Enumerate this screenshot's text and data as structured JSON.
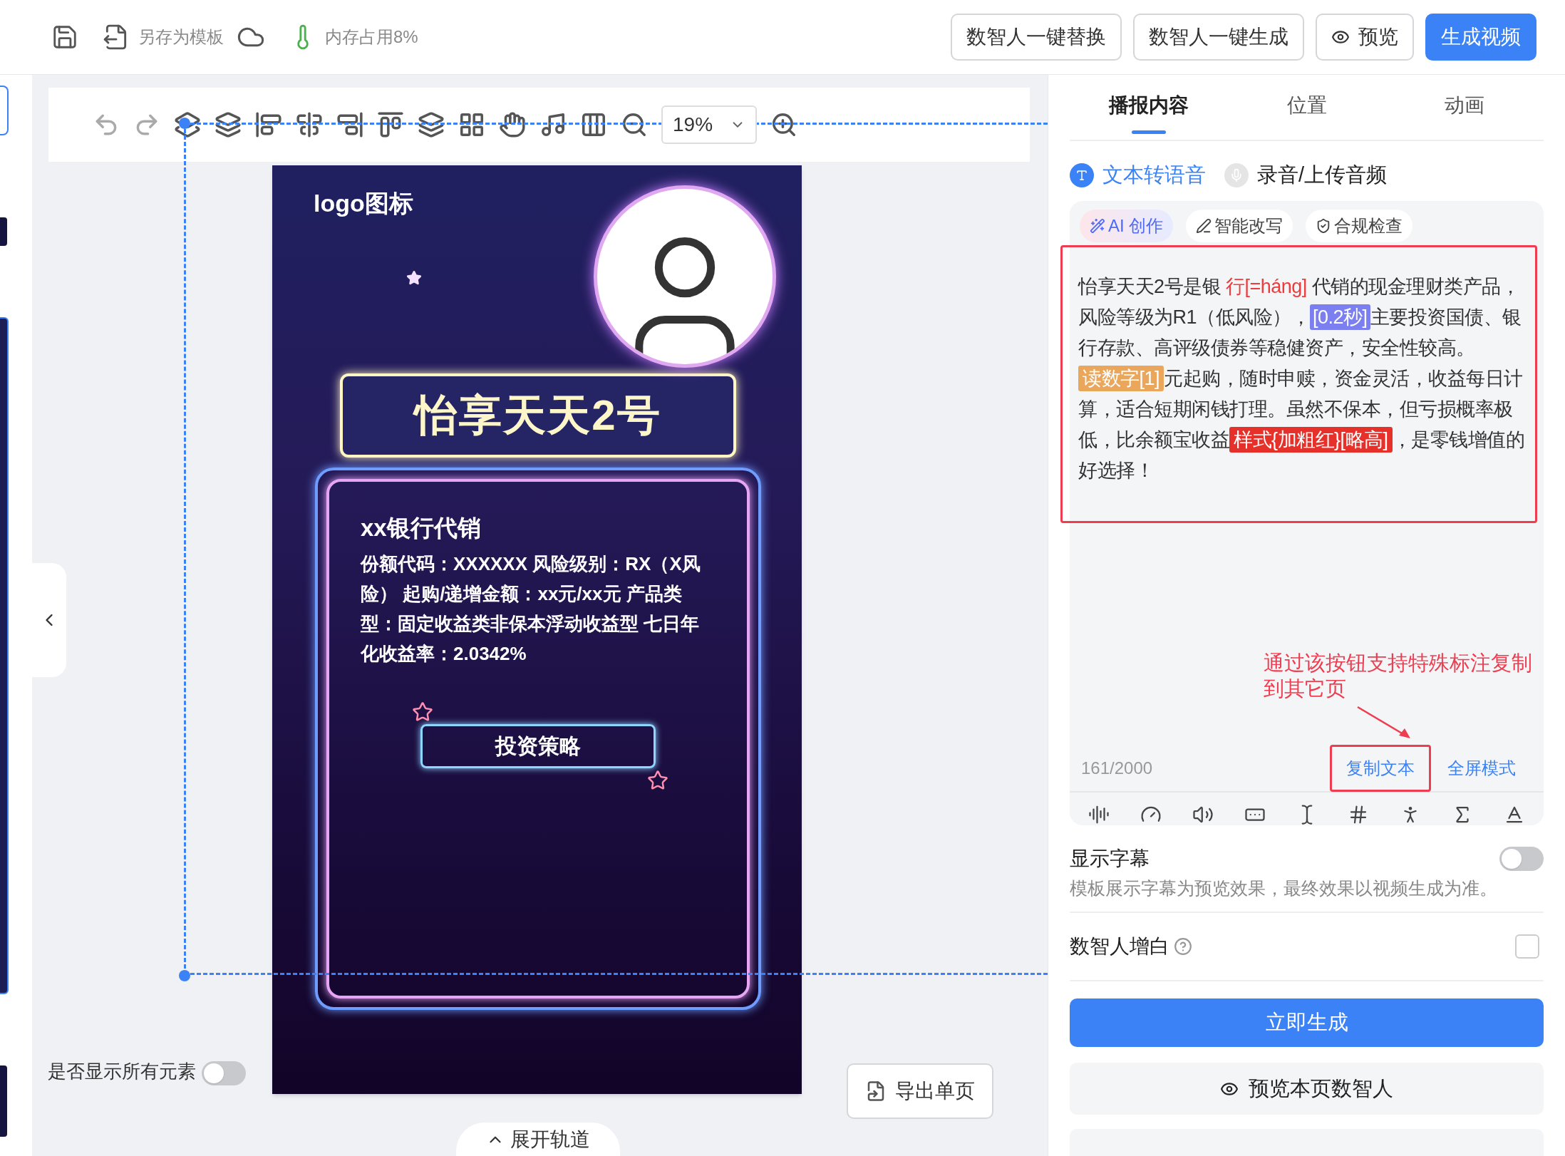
{
  "top_bar": {
    "save_as_template": "另存为模板",
    "memory_usage": "内存占用8%",
    "buttons": [
      {
        "label": "数智人一键替换",
        "kind": "outline"
      },
      {
        "label": "数智人一键生成",
        "kind": "outline"
      },
      {
        "label": "预览",
        "kind": "preview"
      },
      {
        "label": "生成视频",
        "kind": "primary"
      }
    ]
  },
  "editor_toolbar": {
    "zoom": "19%"
  },
  "poster": {
    "logo": "logo图标",
    "title": "怡享天天2号",
    "card_heading": "xx银行代销",
    "card_body": "份额代码：XXXXXX 风险级别：RX（X风险） 起购/递增金额：xx元/xx元 产品类型：固定收益类非保本浮动收益型 七日年化收益率：2.0342%",
    "button": "投资策略"
  },
  "canvas_footer": {
    "show_all_elements": {
      "label": "是否显示所有元素",
      "on": false
    },
    "export_button": "导出单页",
    "expand_track": "展开轨道"
  },
  "panel": {
    "tabs": [
      {
        "label": "播报内容",
        "selected": true
      },
      {
        "label": "位置",
        "selected": false
      },
      {
        "label": "动画",
        "selected": false
      }
    ],
    "modes": [
      {
        "label": "文本转语音",
        "kind": "tts",
        "selected": true
      },
      {
        "label": "录音/上传音频",
        "kind": "record",
        "selected": false
      }
    ],
    "chips": [
      {
        "label": "AI 创作",
        "kind": "ai"
      },
      {
        "label": "智能改写",
        "kind": "rewrite"
      },
      {
        "label": "合规检查",
        "kind": "compliance"
      }
    ],
    "script": [
      {
        "kind": "text",
        "text": "怡享天天2号是银 "
      },
      {
        "kind": "pinyin",
        "text": "行[=háng]"
      },
      {
        "kind": "text",
        "text": " 代销的现金理财类产品，风险等级为R1（低风险），"
      },
      {
        "kind": "pause",
        "text": "[0.2秒]"
      },
      {
        "kind": "text",
        "text": "主要投资国债、银行存款、高评级债券等稳健资产，安全性较高。"
      },
      {
        "kind": "number",
        "text": "读数字[1]"
      },
      {
        "kind": "text",
        "text": "元起购，随时申赎，资金灵活，收益每日计算，适合短期闲钱打理。虽然不保本，但亏损概率极低，比余额宝收益"
      },
      {
        "kind": "style",
        "text": "样式{加粗红}[略高]"
      },
      {
        "kind": "text",
        "text": "，是零钱增值的好选择！"
      }
    ],
    "annotation": "通过该按钮支持特殊标注复制到其它页",
    "counter": "161/2000",
    "actions": [
      {
        "label": "复制文本",
        "highlighted": true
      },
      {
        "label": "全屏模式",
        "highlighted": false
      }
    ],
    "subtitles": {
      "label": "显示字幕",
      "on": false,
      "note": "模板展示字幕为预览效果，最终效果以视频生成为准。"
    },
    "whiten": {
      "label": "数智人增白",
      "checked": false
    },
    "generate_button": "立即生成",
    "preview_button": "预览本页数智人"
  }
}
